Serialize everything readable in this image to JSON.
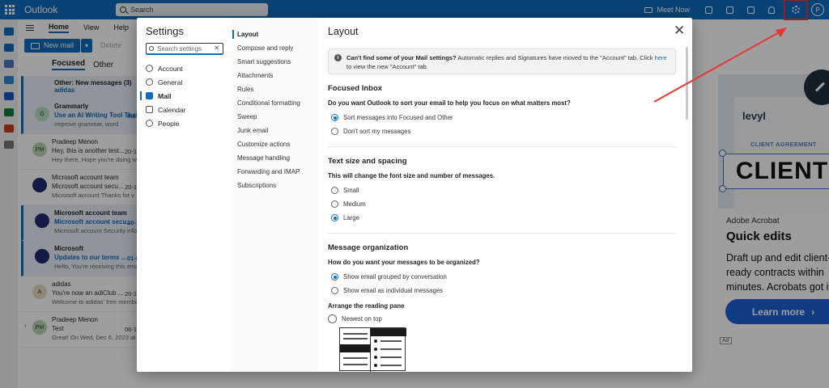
{
  "app": {
    "name": "Outlook",
    "search_placeholder": "Search"
  },
  "topbar": {
    "meet_now": "Meet Now",
    "avatar_initial": "P"
  },
  "ribbon": {
    "tabs": [
      "Home",
      "View",
      "Help"
    ],
    "new_mail": "New mail",
    "delete": "Delete"
  },
  "folder_tabs": {
    "focused": "Focused",
    "other": "Other"
  },
  "message_group": {
    "title": "Other: New messages (3)",
    "sender": "adidas"
  },
  "messages": [
    {
      "initials": "G",
      "from": "Grammarly",
      "subject": "Use an AI Writing Tool That Ad",
      "preview": "Improve grammar, word",
      "date": "Inst",
      "unread": true,
      "avatar_color": "#b7e0c3"
    },
    {
      "initials": "PM",
      "from": "Pradeep Menon",
      "subject": "Hey, this is another test...",
      "preview": "Hey there, Hope you're doing w",
      "date": "20-1",
      "unread": false,
      "avatar_color": "#b9d9b0"
    },
    {
      "initials": "",
      "from": "Microsoft account team",
      "subject": "Microsoft account secu...",
      "preview": "Microsoft account Thanks for v",
      "date": "20-1",
      "unread": false,
      "avatar_color": "#1f2b6e"
    },
    {
      "initials": "",
      "from": "Microsoft account team",
      "subject": "Microsoft account secu...",
      "preview": "Microsoft account Security info",
      "date": "20-1",
      "unread": true,
      "avatar_color": "#1f2b6e"
    },
    {
      "initials": "",
      "from": "Microsoft",
      "subject": "Updates to our terms ...",
      "preview": "Hello, You're receiving this emai",
      "date": "01-0",
      "unread": true,
      "avatar_color": "#1f2b6e"
    },
    {
      "initials": "A",
      "from": "adidas",
      "subject": "You're now an adiClub ...",
      "preview": "Welcome to adidas' free membe",
      "date": "20-1",
      "unread": false,
      "avatar_color": "#e8dcc0"
    },
    {
      "initials": "PM",
      "from": "Pradeep Menon",
      "subject": "Test",
      "preview": "Great! On Wed, Dec 6, 2023 at",
      "date": "06-1",
      "unread": false,
      "avatar_color": "#b9d9b0",
      "expandable": true
    }
  ],
  "ad": {
    "brand": "levyl",
    "doc_title": "CLIENT AGREEMENT",
    "big_word": "CLIENT",
    "maker": "Adobe Acrobat",
    "headline": "Quick edits",
    "body": "Draft up and edit client-ready contracts within minutes. Acrobats got it.",
    "cta": "Learn more",
    "ad_tag": "Ad"
  },
  "settings": {
    "title": "Settings",
    "search_placeholder": "Search settings",
    "categories": [
      {
        "label": "Account",
        "selected": false
      },
      {
        "label": "General",
        "selected": false
      },
      {
        "label": "Mail",
        "selected": true
      },
      {
        "label": "Calendar",
        "selected": false
      },
      {
        "label": "People",
        "selected": false
      }
    ],
    "subcategories": [
      {
        "label": "Layout",
        "selected": true
      },
      {
        "label": "Compose and reply",
        "selected": false
      },
      {
        "label": "Smart suggestions",
        "selected": false
      },
      {
        "label": "Attachments",
        "selected": false
      },
      {
        "label": "Rules",
        "selected": false
      },
      {
        "label": "Conditional formatting",
        "selected": false
      },
      {
        "label": "Sweep",
        "selected": false
      },
      {
        "label": "Junk email",
        "selected": false
      },
      {
        "label": "Customize actions",
        "selected": false
      },
      {
        "label": "Message handling",
        "selected": false
      },
      {
        "label": "Forwarding and IMAP",
        "selected": false
      },
      {
        "label": "Subscriptions",
        "selected": false
      }
    ],
    "page_title": "Layout",
    "info": {
      "bold": "Can't find some of your Mail settings?",
      "text": " Automatic replies and Signatures have moved to the \"Account\" tab. Click ",
      "link": "here",
      "text_after": " to view the new \"Account\" tab."
    },
    "focused_inbox": {
      "heading": "Focused Inbox",
      "question": "Do you want Outlook to sort your email to help you focus on what matters most?",
      "options": [
        {
          "label": "Sort messages into Focused and Other",
          "checked": true
        },
        {
          "label": "Don't sort my messages",
          "checked": false
        }
      ]
    },
    "text_size": {
      "heading": "Text size and spacing",
      "question": "This will change the font size and number of messages.",
      "options": [
        {
          "label": "Small",
          "checked": false
        },
        {
          "label": "Medium",
          "checked": false
        },
        {
          "label": "Large",
          "checked": true
        }
      ]
    },
    "message_org": {
      "heading": "Message organization",
      "question": "How do you want your messages to be organized?",
      "options": [
        {
          "label": "Show email grouped by conversation",
          "checked": true
        },
        {
          "label": "Show email as individual messages",
          "checked": false
        }
      ]
    },
    "reading_pane": {
      "label": "Arrange the reading pane",
      "options": [
        {
          "label": "Newest on top",
          "checked": false
        }
      ]
    }
  },
  "colors": {
    "brand_blue": "#0f6cbd",
    "annotation_red": "#e53935"
  }
}
